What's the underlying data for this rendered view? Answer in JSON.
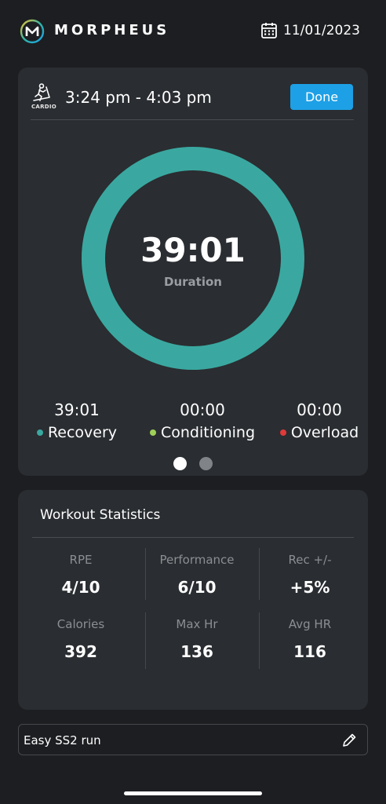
{
  "app": {
    "brand": "MORPHEUS",
    "logo_letter": "M"
  },
  "header": {
    "date": "11/01/2023",
    "icon": "calendar-icon"
  },
  "workout": {
    "type_label": "CARDIO",
    "time_range": "3:24 pm - 4:03 pm",
    "done_label": "Done",
    "duration_value": "39:01",
    "duration_label": "Duration",
    "ring_fraction": 1.0,
    "zones": [
      {
        "value": "39:01",
        "label": "Recovery",
        "color": "#3aa8a0"
      },
      {
        "value": "00:00",
        "label": "Conditioning",
        "color": "#9fd15a"
      },
      {
        "value": "00:00",
        "label": "Overload",
        "color": "#e03a3a"
      }
    ],
    "pager": {
      "pages": 2,
      "active": 0
    }
  },
  "stats": {
    "title": "Workout Statistics",
    "items": [
      {
        "label": "RPE",
        "value": "4/10"
      },
      {
        "label": "Performance",
        "value": "6/10"
      },
      {
        "label": "Rec +/-",
        "value": "+5%"
      },
      {
        "label": "Calories",
        "value": "392"
      },
      {
        "label": "Max Hr",
        "value": "136"
      },
      {
        "label": "Avg HR",
        "value": "116"
      }
    ]
  },
  "notes": {
    "text": "Easy SS2 run",
    "icon": "pencil-icon"
  },
  "colors": {
    "accent": "#1da0e6",
    "ring": "#3aa8a0",
    "card": "#2a2d31",
    "background": "#1c1e21"
  }
}
